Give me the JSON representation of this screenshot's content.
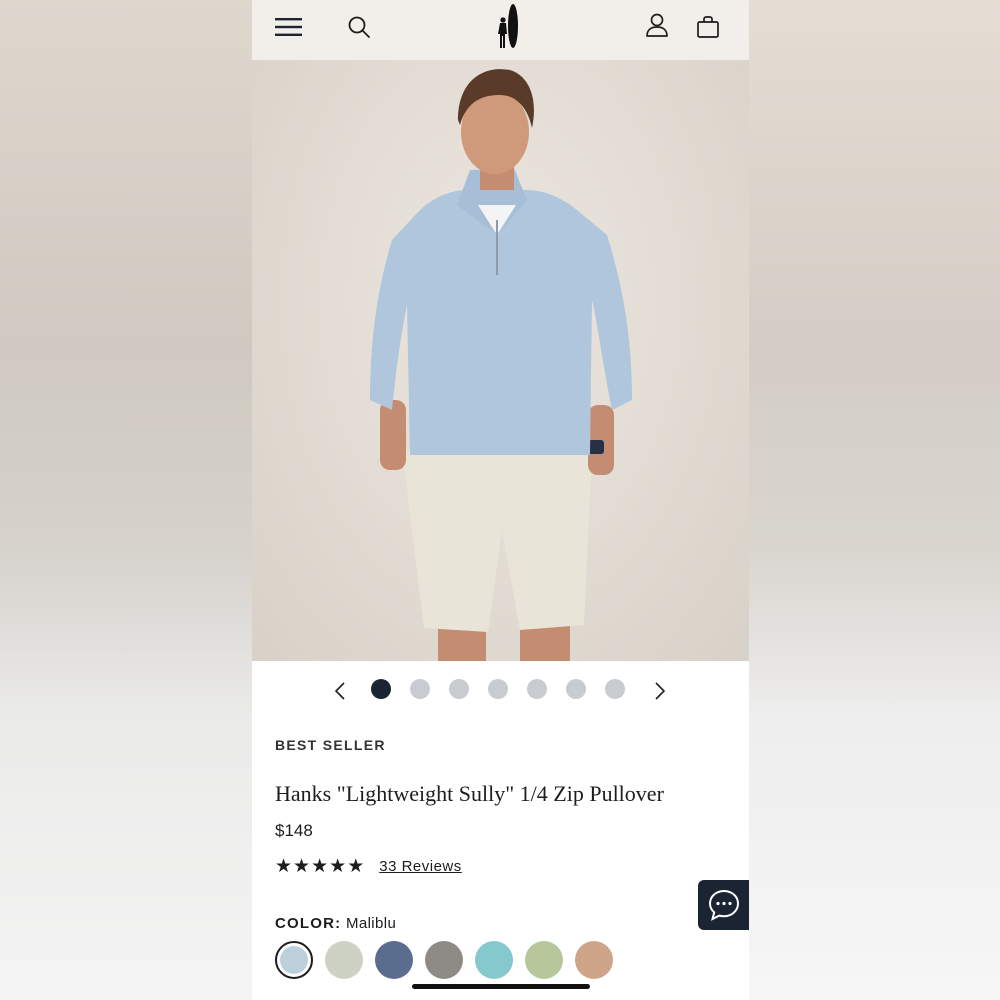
{
  "header": {
    "menu_icon": "hamburger-menu-icon",
    "search_icon": "search-icon",
    "logo_icon": "surfer-logo-icon",
    "account_icon": "user-account-icon",
    "bag_icon": "shopping-bag-icon"
  },
  "carousel": {
    "slide_count": 7,
    "active_index": 0
  },
  "product": {
    "badge": "BEST SELLER",
    "title": "Hanks \"Lightweight Sully\" 1/4 Zip Pullover",
    "price": "$148",
    "rating": 5,
    "reviews_label": "33 Reviews"
  },
  "color": {
    "label": "COLOR:",
    "selected": "Maliblu",
    "swatches": [
      "#bcd0dc",
      "#cdd2c5",
      "#5a6d8f",
      "#8e8a85",
      "#86c9cc",
      "#b7c79c",
      "#cfa58a"
    ]
  },
  "colors": {
    "navy": "#1a2433",
    "topbar_bg": "#f2efea"
  }
}
